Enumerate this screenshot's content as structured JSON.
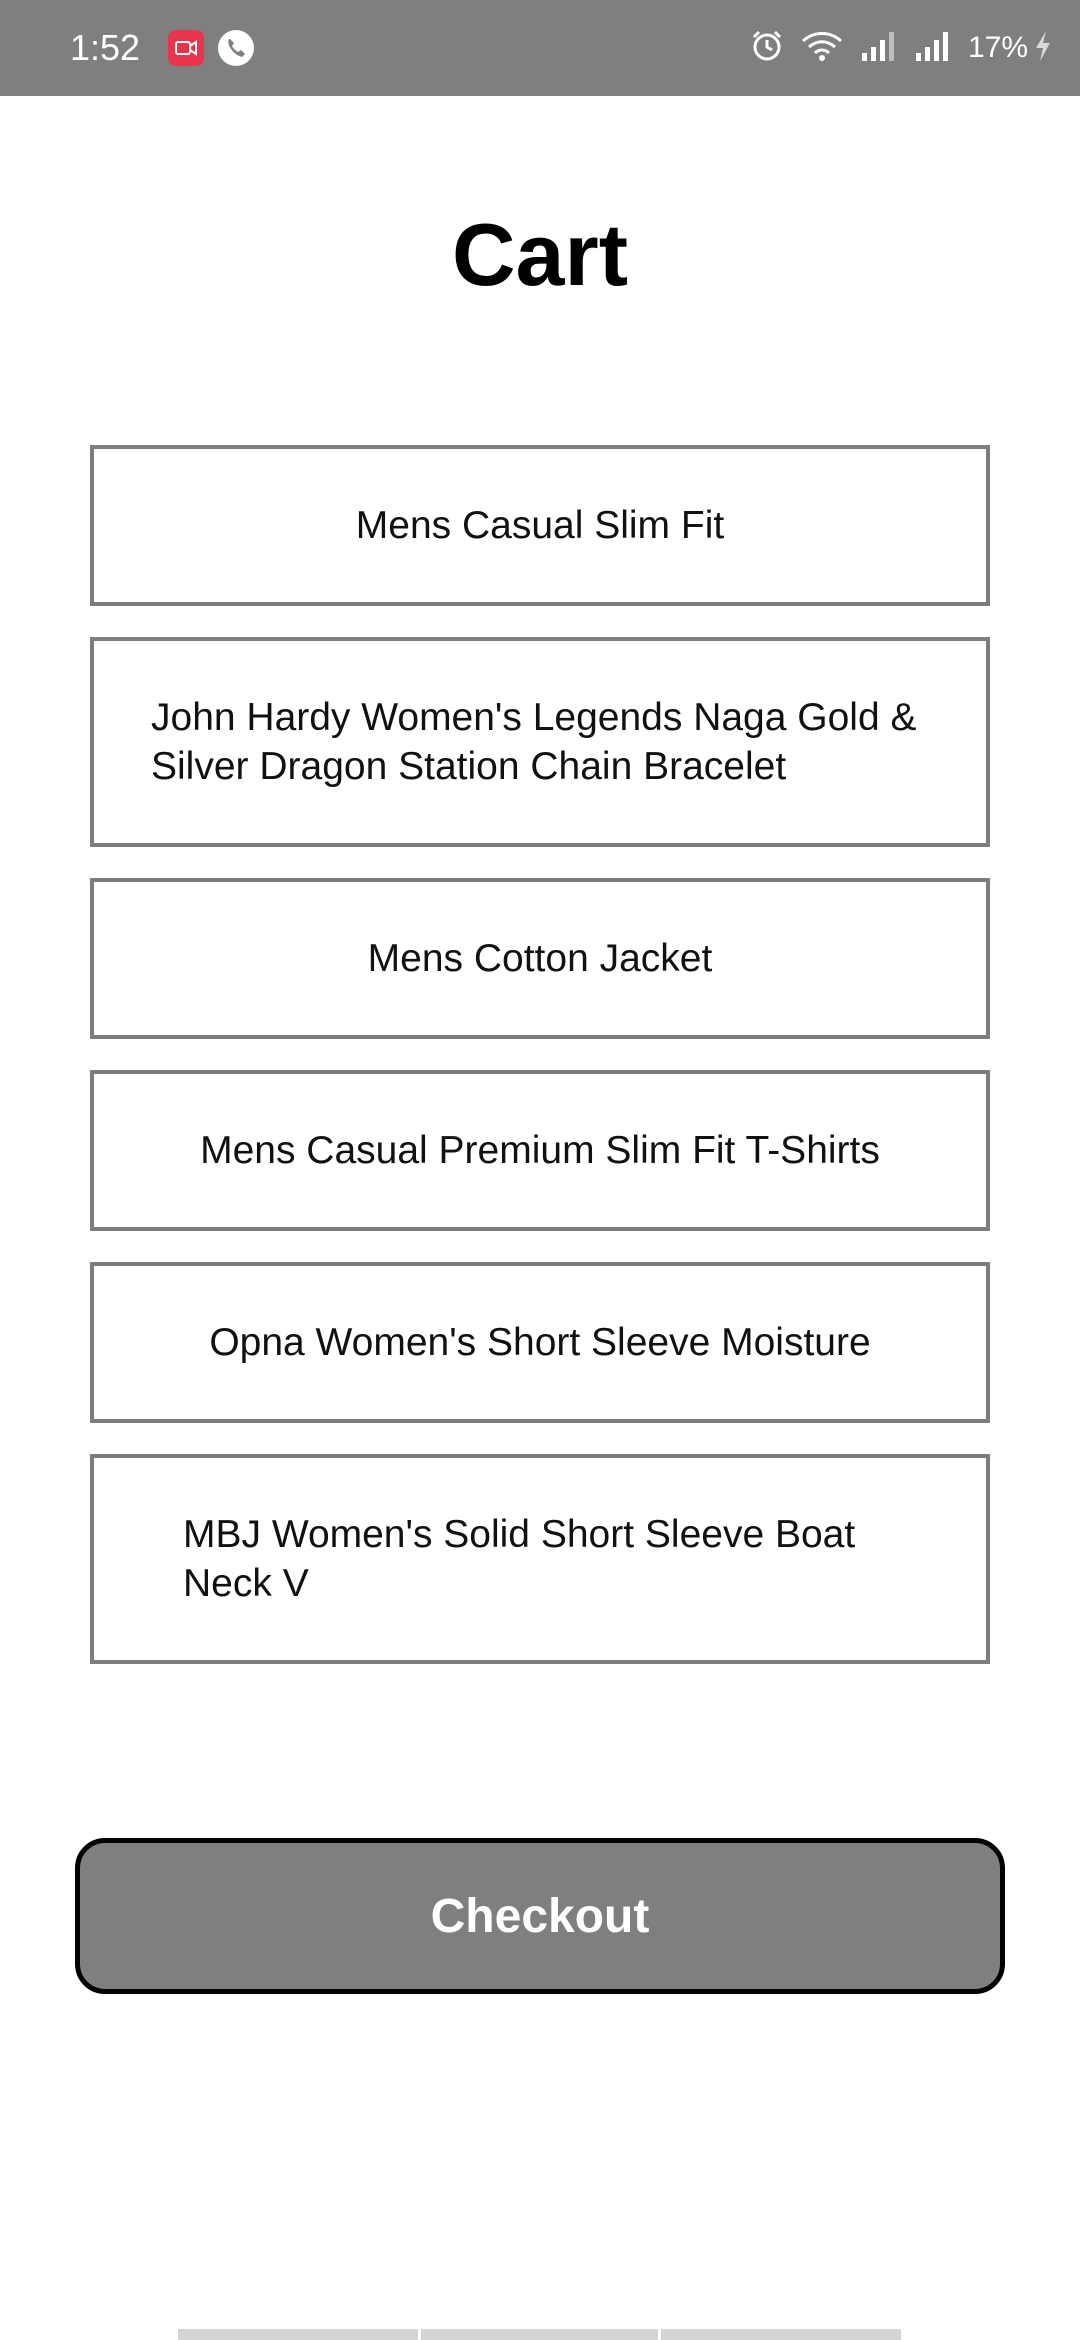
{
  "status_bar": {
    "time": "1:52",
    "battery": "17%",
    "icons": [
      "screen-record-icon",
      "phone-call-icon",
      "alarm-icon",
      "wifi-icon",
      "signal-icon",
      "signal-icon-2",
      "charging-icon"
    ],
    "colors": {
      "background": "#7f7f7f",
      "record_badge": "#e8354b"
    }
  },
  "page": {
    "title": "Cart"
  },
  "cart": {
    "items": [
      {
        "label": "Mens Casual Slim Fit"
      },
      {
        "label": "John Hardy Women's Legends Naga Gold & Silver Dragon Station Chain Bracelet"
      },
      {
        "label": "Mens Cotton Jacket"
      },
      {
        "label": "Mens Casual Premium Slim Fit T-Shirts"
      },
      {
        "label": "Opna Women's Short Sleeve Moisture"
      },
      {
        "label": "MBJ Women's Solid Short Sleeve Boat Neck V"
      }
    ]
  },
  "checkout": {
    "label": "Checkout",
    "colors": {
      "background": "#7f7f7f",
      "border": "#000000",
      "text": "#ffffff"
    }
  }
}
